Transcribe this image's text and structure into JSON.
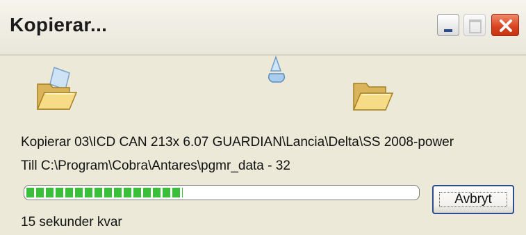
{
  "window": {
    "title": "Kopierar...",
    "controls": {
      "minimize_icon": "minimize-icon",
      "maximize_icon": "maximize-icon",
      "close_icon": "close-icon"
    }
  },
  "animation": {
    "source_icon": "folder-open-icon",
    "moving_icon": "flying-document-icon",
    "destination_icon": "folder-open-icon"
  },
  "copy": {
    "from_text": "Kopierar 03\\ICD CAN 213x 6.07 GUARDIAN\\Lancia\\Delta\\SS 2008-power",
    "to_text": "Till C:\\Program\\Cobra\\Antares\\pgmr_data - 32",
    "progress_fraction": 0.4,
    "time_remaining": "15 sekunder kvar"
  },
  "actions": {
    "cancel_label": "Avbryt"
  },
  "colors": {
    "progress": "#3bbf3b",
    "close_button": "#d8421e",
    "focus_border": "#2c4c8c"
  }
}
